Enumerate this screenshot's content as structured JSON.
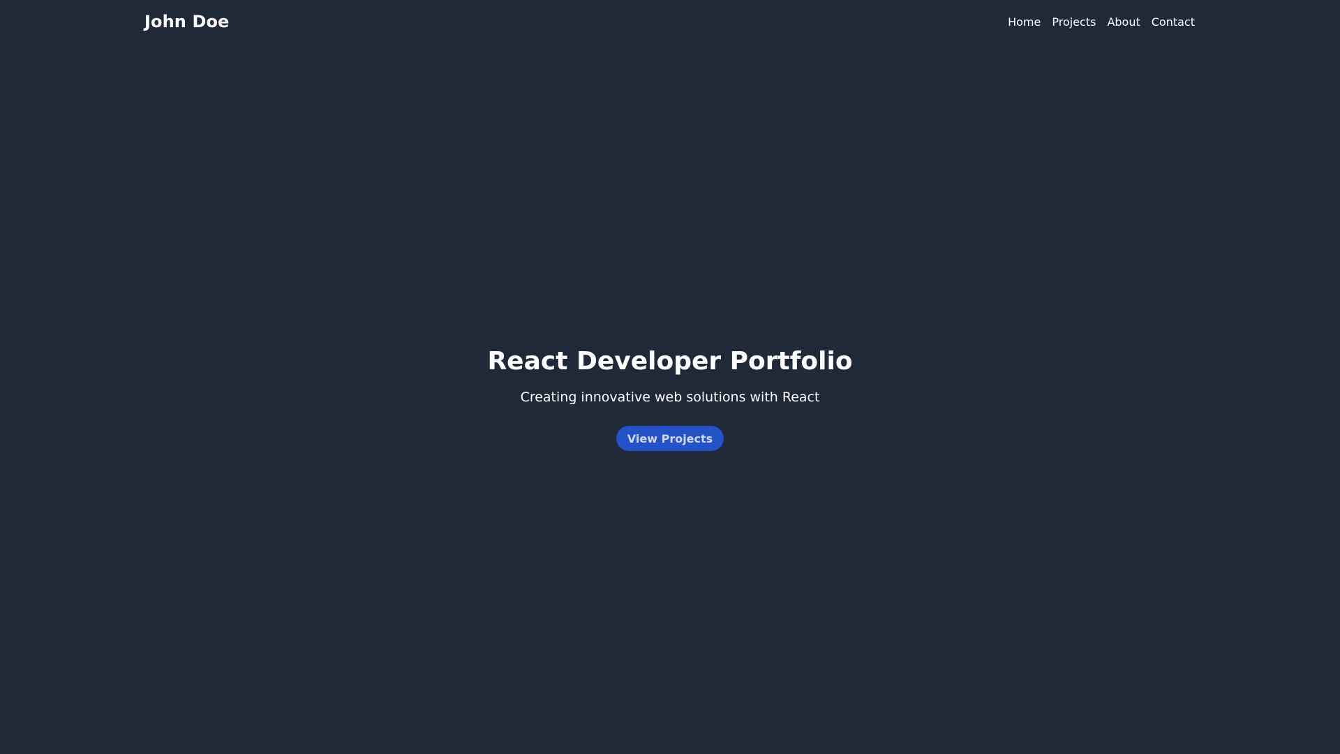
{
  "header": {
    "brand": "John Doe",
    "nav": [
      {
        "label": "Home"
      },
      {
        "label": "Projects"
      },
      {
        "label": "About"
      },
      {
        "label": "Contact"
      }
    ]
  },
  "hero": {
    "title": "React Developer Portfolio",
    "subtitle": "Creating innovative web solutions with React",
    "cta_label": "View Projects"
  },
  "colors": {
    "background": "#1f2937",
    "text": "#ffffff",
    "accent": "#2352c8"
  }
}
